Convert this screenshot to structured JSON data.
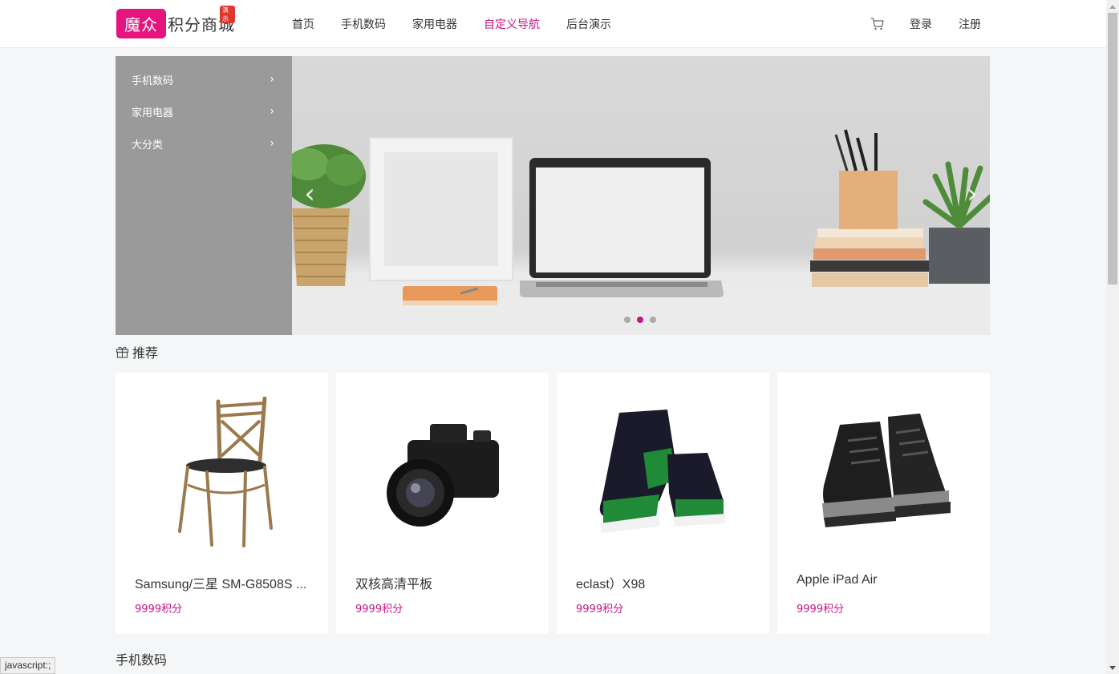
{
  "header": {
    "logo_box": "魔众",
    "logo_text": "积分商城",
    "logo_badge": "演示",
    "nav": [
      {
        "label": "首页",
        "active": false
      },
      {
        "label": "手机数码",
        "active": false
      },
      {
        "label": "家用电器",
        "active": false
      },
      {
        "label": "自定义导航",
        "active": true
      },
      {
        "label": "后台演示",
        "active": false
      }
    ],
    "cart_icon": "cart-icon",
    "login": "登录",
    "register": "注册"
  },
  "side_menu": [
    {
      "label": "手机数码"
    },
    {
      "label": "家用电器"
    },
    {
      "label": "大分类"
    }
  ],
  "banner": {
    "prev": "‹",
    "next": "›",
    "dot_count": 3,
    "active_dot": 1
  },
  "recommend": {
    "title": "推荐",
    "icon": "gift-icon",
    "products": [
      {
        "name": "Samsung/三星 SM-G8508S ...",
        "price": "9999积分",
        "image": "chair"
      },
      {
        "name": "双核高清平板",
        "price": "9999积分",
        "image": "camera"
      },
      {
        "name": "eclast）X98",
        "price": "9999积分",
        "image": "sneakers"
      },
      {
        "name": "Apple iPad Air",
        "price": "9999积分",
        "image": "boots"
      }
    ]
  },
  "section2": {
    "title": "手机数码"
  },
  "status_bar": "javascript:;",
  "colors": {
    "brand": "#e4157f",
    "accent": "#c71585",
    "side_menu_bg": "#9b9a9b"
  }
}
